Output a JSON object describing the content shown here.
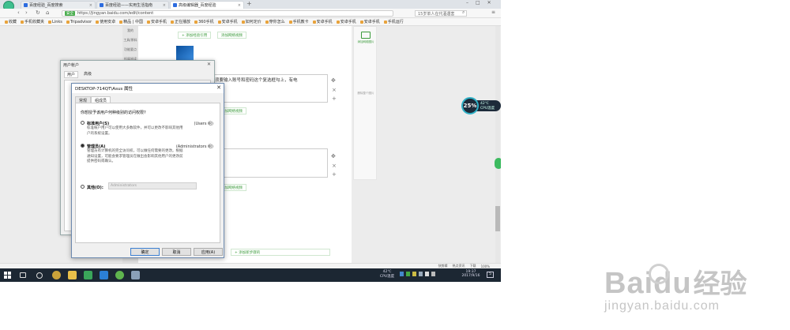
{
  "browser": {
    "tabs": [
      {
        "label": "百度经验_百度搜索"
      },
      {
        "label": "百度经验——实用生活指南"
      },
      {
        "label": "高级编辑器_百度经验"
      }
    ],
    "secure_label": "安全",
    "url": "https://jingyan.baidu.com/edit/content",
    "search_placeholder": "15岁单人在代酒遇害",
    "bookmarks": [
      "收藏",
      "手机收藏夹",
      "Links",
      "Tripadvisor",
      "使用安卓",
      "精品 | 中国",
      "安卓手机",
      "正在播放",
      "360手机",
      "安卓手机",
      "如何定价",
      "穿你怎么",
      "手机教卡",
      "安卓手机",
      "安卓手机",
      "安卓手机",
      "手机运行"
    ]
  },
  "page": {
    "left_menu": [
      "我的",
      "工具/原料",
      "功能要点",
      "拓展阅读"
    ],
    "add_experience_label": "+ 添加经验引用",
    "add_video_label": "添加网络视频",
    "step_text": "使用本机，用户必须要输入账号和密码这个复选框勾上，有电\n算这个原因。",
    "add_last_step_label": "+ 添加新步骤的",
    "right_panel_title": "添加网络图片",
    "right_panel_hint": "删除整个图片"
  },
  "cpu_widget": {
    "percent": "25%",
    "temp": "42℃",
    "label": "CPU温度"
  },
  "status_bar": {
    "items": [
      "快剪辑",
      "热点资讯",
      "下载",
      "100%"
    ]
  },
  "taskbar": {
    "temp": "42℃",
    "temp_label": "CPU温度",
    "time": "19:37",
    "date": "2017/9/16",
    "notification_count": "5"
  },
  "user_accounts_dialog": {
    "title": "用户帐户",
    "tabs": [
      "用户",
      "高级"
    ]
  },
  "properties_dialog": {
    "title": "DESKTOP-714QT\\Asus 属性",
    "tabs": [
      "常规",
      "组成员"
    ],
    "question": "你想授予该用户何种级别的访问权限?",
    "options": [
      {
        "label": "标准用户(S)",
        "group": "(Users 组)",
        "desc": "标准帐户用户可以使用大多数软件，并可以更改不影响其他用\n户的系统设置。",
        "selected": false
      },
      {
        "label": "管理员(A)",
        "group": "(Administrators 组)",
        "desc": "管理员有计算机的完全访问权，可以做任何需要的更改。根据\n通知设置，可能会要求管理员在做出会影响其他用户的更改前\n提供密码或确认。",
        "selected": true
      },
      {
        "label": "其他(O):",
        "group": "",
        "desc": "",
        "selected": false
      }
    ],
    "other_value": "Administrators",
    "buttons": {
      "ok": "确定",
      "cancel": "取消",
      "apply": "应用(A)"
    }
  },
  "watermark": {
    "brand": "Baidu",
    "brand_cn": "经验",
    "url": "jingyan.baidu.com"
  }
}
